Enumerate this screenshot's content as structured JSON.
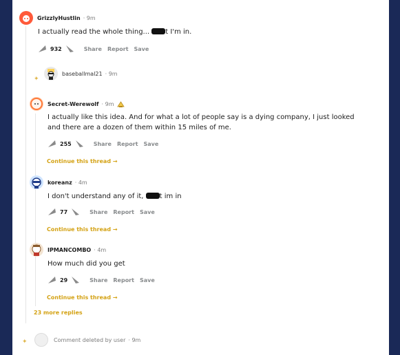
{
  "colors": {
    "background": "#1a2957",
    "accent": "#d4a214",
    "meta": "#7c7c7c"
  },
  "comments": [
    {
      "username": "GrizzlyHustlin",
      "time": "9m",
      "text_before": "I actually read the whole thing... ",
      "text_after": "t I'm in.",
      "score": "932"
    },
    {
      "username": "baseballmal21",
      "time": "9m"
    },
    {
      "username": "Secret-Werewolf",
      "time": "9m",
      "text": "I actually like this idea. And for what a lot of people say is a dying company, I just looked and there are a dozen of them within 15 miles of me.",
      "score": "255",
      "continue": "Continue this thread"
    },
    {
      "username": "koreanz",
      "time": "4m",
      "text_before": "I don't understand any of it, ",
      "text_after": "t im in",
      "score": "77",
      "continue": "Continue this thread"
    },
    {
      "username": "IPMANCOMBO",
      "time": "4m",
      "text": "How much did you get",
      "score": "29",
      "continue": "Continue this thread"
    }
  ],
  "actions": {
    "share": "Share",
    "report": "Report",
    "save": "Save"
  },
  "more_replies": "23 more replies",
  "deleted": {
    "text": "Comment deleted by user",
    "time": "9m"
  },
  "icons": [
    "upvote-icon",
    "downvote-icon",
    "arrow-right-icon",
    "award-icon",
    "sparkle-icon"
  ]
}
